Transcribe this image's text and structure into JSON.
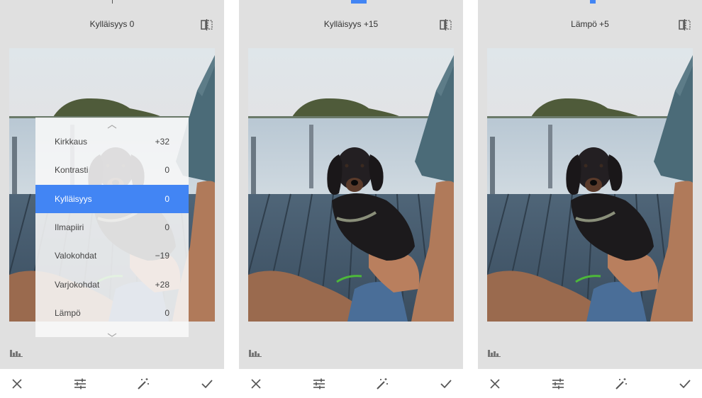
{
  "colors": {
    "accent": "#4285f4",
    "panel_bg": "#e0e0e0",
    "icon": "#555555"
  },
  "panels": [
    {
      "title": "Kylläisyys 0",
      "menu": {
        "items": [
          {
            "label": "Kirkkaus",
            "value": "+32"
          },
          {
            "label": "Kontrasti",
            "value": "0"
          },
          {
            "label": "Kylläisyys",
            "value": "0"
          },
          {
            "label": "Ilmapiiri",
            "value": "0"
          },
          {
            "label": "Valokohdat",
            "value": "−19"
          },
          {
            "label": "Varjokohdat",
            "value": "+28"
          },
          {
            "label": "Lämpö",
            "value": "0"
          }
        ],
        "selected_index": 2
      }
    },
    {
      "title": "Kylläisyys +15"
    },
    {
      "title": "Lämpö +5"
    }
  ],
  "icons": {
    "compare": "compare-icon",
    "histogram": "histogram-icon",
    "cancel": "close-icon",
    "adjust": "sliders-icon",
    "auto": "magic-wand-icon",
    "apply": "checkmark-icon"
  }
}
